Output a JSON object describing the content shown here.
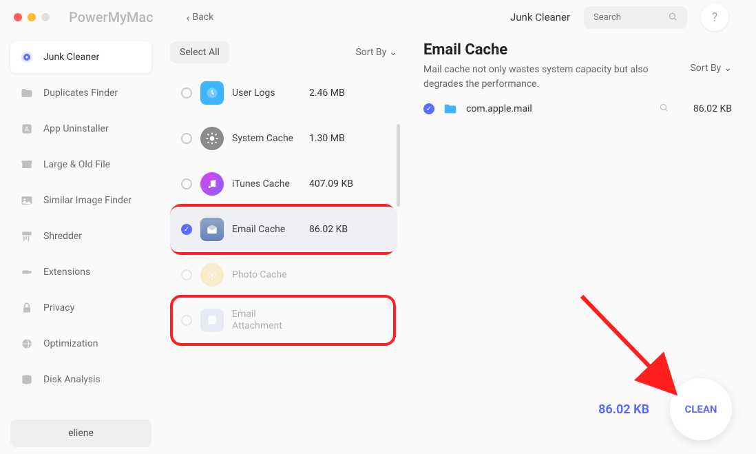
{
  "app": {
    "name": "PowerMyMac",
    "back_label": "Back",
    "header_title": "Junk Cleaner"
  },
  "search": {
    "placeholder": "Search"
  },
  "sidebar": {
    "items": [
      {
        "label": "Junk Cleaner"
      },
      {
        "label": "Duplicates Finder"
      },
      {
        "label": "App Uninstaller"
      },
      {
        "label": "Large & Old File"
      },
      {
        "label": "Similar Image Finder"
      },
      {
        "label": "Shredder"
      },
      {
        "label": "Extensions"
      },
      {
        "label": "Privacy"
      },
      {
        "label": "Optimization"
      },
      {
        "label": "Disk Analysis"
      }
    ],
    "profile": "eliene"
  },
  "middle": {
    "select_all": "Select All",
    "sort_by": "Sort By",
    "categories": [
      {
        "name": "User Logs",
        "size": "2.46 MB",
        "color": "#3bb5ff"
      },
      {
        "name": "System Cache",
        "size": "1.30 MB",
        "color": "#8b8b8b"
      },
      {
        "name": "iTunes Cache",
        "size": "407.09 KB",
        "color": "#b447ff"
      },
      {
        "name": "Email Cache",
        "size": "86.02 KB",
        "color": "#6a83b8"
      },
      {
        "name": "Photo Cache",
        "size": "",
        "color": "#f5c16a"
      },
      {
        "name": "Email Attachment",
        "size": "",
        "color": "#b8c6e0"
      }
    ]
  },
  "right": {
    "title": "Email Cache",
    "desc": "Mail cache not only wastes system capacity but also degrades the performance.",
    "sort_by": "Sort By",
    "files": [
      {
        "name": "com.apple.mail",
        "size": "86.02 KB"
      }
    ],
    "total_size": "86.02 KB",
    "clean_label": "CLEAN"
  },
  "colors": {
    "accent": "#5b6bff",
    "highlight": "#ff1f1f"
  }
}
